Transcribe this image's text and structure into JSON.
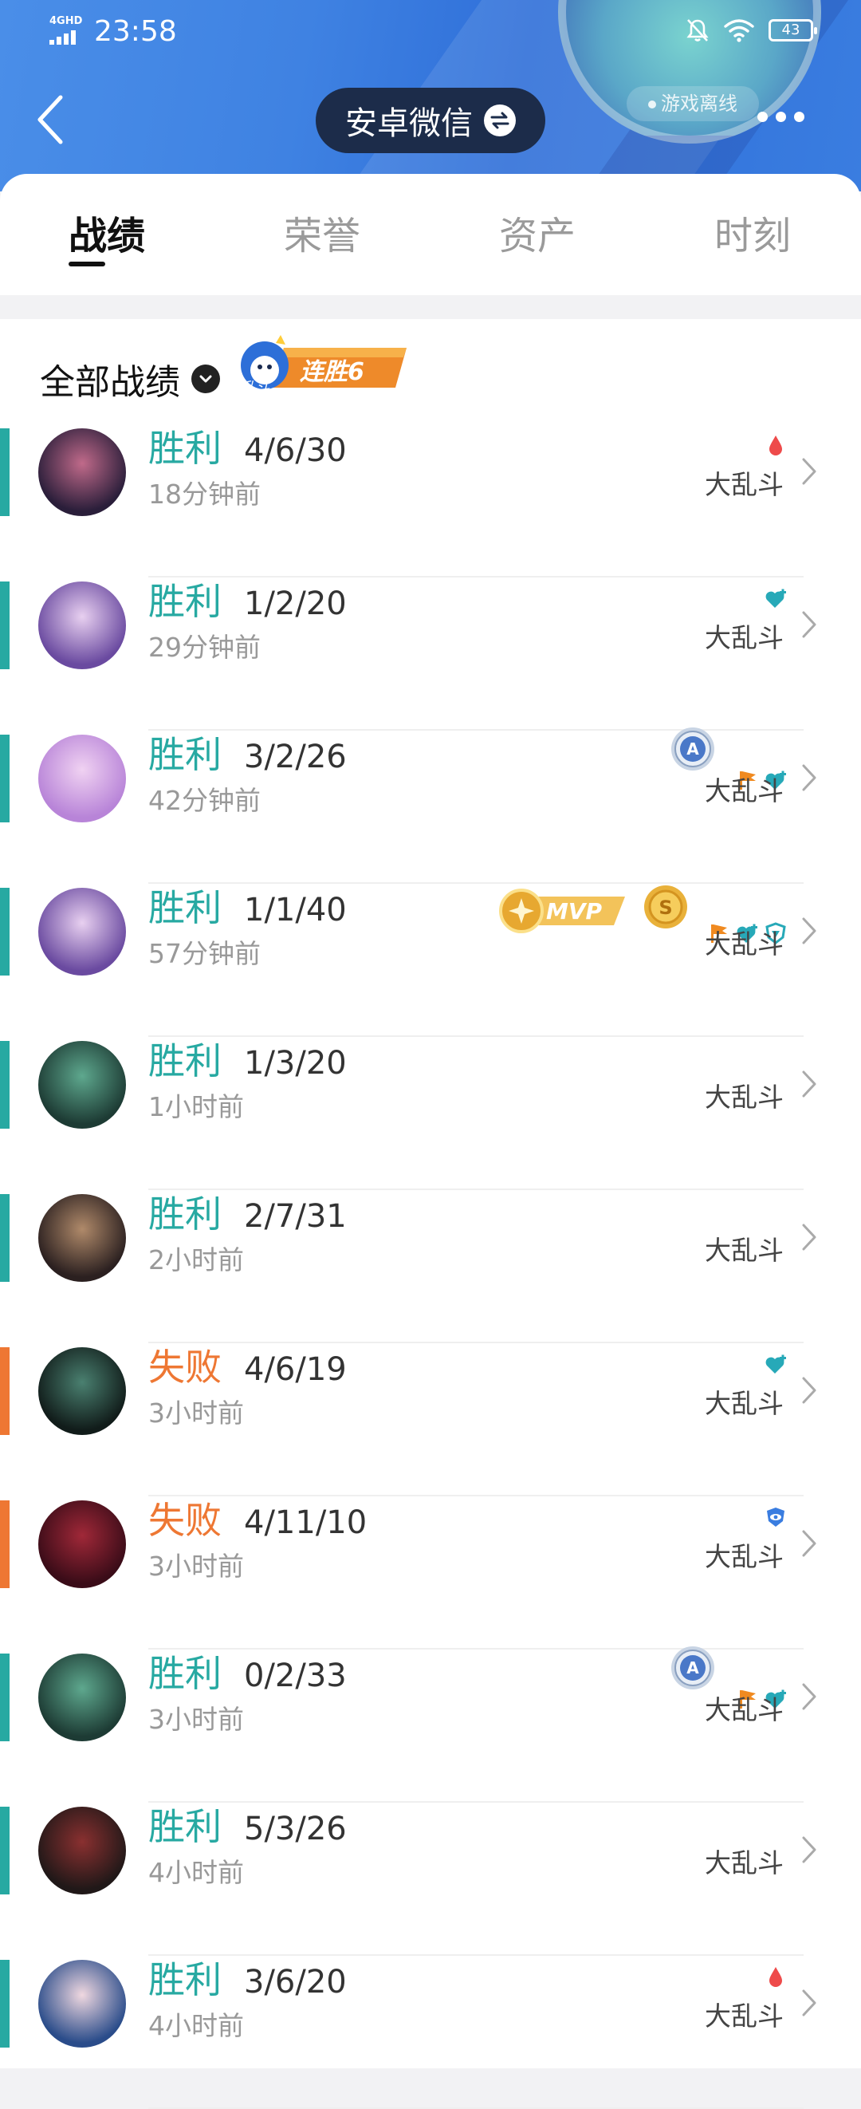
{
  "status_bar": {
    "network": "4GHD",
    "time": "23:58",
    "battery": "43"
  },
  "header": {
    "account_name": "安卓微信",
    "offline_status": "游戏离线"
  },
  "tabs": [
    {
      "label": "战绩",
      "active": true
    },
    {
      "label": "荣誉",
      "active": false
    },
    {
      "label": "资产",
      "active": false
    },
    {
      "label": "时刻",
      "active": false
    }
  ],
  "filter": {
    "label": "全部战绩",
    "streak_mode": "乱斗",
    "streak_text": "连胜6"
  },
  "colors": {
    "win": "#27a9a2",
    "lose": "#ee7733",
    "header": "#3f82e2"
  },
  "matches": [
    {
      "result": "胜利",
      "kda": "4/6/30",
      "time": "18分钟前",
      "mode": "大乱斗",
      "win": true,
      "icons": [
        "blood-drop-icon"
      ],
      "avatar": [
        "#2a1e3a",
        "#c06a8a"
      ]
    },
    {
      "result": "胜利",
      "kda": "1/2/20",
      "time": "29分钟前",
      "mode": "大乱斗",
      "win": true,
      "icons": [
        "heal-heart-icon"
      ],
      "avatar": [
        "#6a4aa0",
        "#e8d0f0"
      ]
    },
    {
      "result": "胜利",
      "kda": "3/2/26",
      "time": "42分钟前",
      "mode": "大乱斗",
      "win": true,
      "icons": [
        "flag-icon",
        "heal-heart-icon"
      ],
      "medal": "A",
      "avatar": [
        "#b884d8",
        "#f0d2f2"
      ]
    },
    {
      "result": "胜利",
      "kda": "1/1/40",
      "time": "57分钟前",
      "mode": "大乱斗",
      "win": true,
      "icons": [
        "flag-icon",
        "heal-heart-icon",
        "shield-icon"
      ],
      "mvp": "MVP",
      "coin": "S",
      "avatar": [
        "#6a4aa0",
        "#e8d0f0"
      ]
    },
    {
      "result": "胜利",
      "kda": "1/3/20",
      "time": "1小时前",
      "mode": "大乱斗",
      "win": true,
      "icons": [],
      "avatar": [
        "#1d3b34",
        "#5ea88e"
      ]
    },
    {
      "result": "胜利",
      "kda": "2/7/31",
      "time": "2小时前",
      "mode": "大乱斗",
      "win": true,
      "icons": [],
      "avatar": [
        "#2b2020",
        "#b08a6a"
      ]
    },
    {
      "result": "失败",
      "kda": "4/6/19",
      "time": "3小时前",
      "mode": "大乱斗",
      "win": false,
      "icons": [
        "heal-heart-icon"
      ],
      "avatar": [
        "#111c1a",
        "#4a8070"
      ]
    },
    {
      "result": "失败",
      "kda": "4/11/10",
      "time": "3小时前",
      "mode": "大乱斗",
      "win": false,
      "icons": [
        "eye-shield-icon"
      ],
      "avatar": [
        "#3a0c18",
        "#a02838"
      ]
    },
    {
      "result": "胜利",
      "kda": "0/2/33",
      "time": "3小时前",
      "mode": "大乱斗",
      "win": true,
      "icons": [
        "flag-icon",
        "heal-heart-icon"
      ],
      "medal": "A",
      "avatar": [
        "#1d3b34",
        "#5ea88e"
      ]
    },
    {
      "result": "胜利",
      "kda": "5/3/26",
      "time": "4小时前",
      "mode": "大乱斗",
      "win": true,
      "icons": [],
      "avatar": [
        "#201818",
        "#8a3030"
      ]
    },
    {
      "result": "胜利",
      "kda": "3/6/20",
      "time": "4小时前",
      "mode": "大乱斗",
      "win": true,
      "icons": [
        "blood-drop-icon"
      ],
      "avatar": [
        "#2a4c8a",
        "#f0d8e0"
      ]
    }
  ]
}
